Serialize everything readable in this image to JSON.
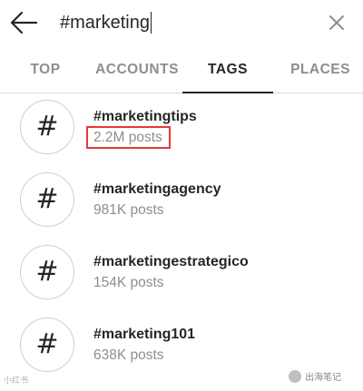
{
  "search": {
    "query": "#marketing"
  },
  "tabs": [
    {
      "label": "TOP",
      "active": false
    },
    {
      "label": "ACCOUNTS",
      "active": false
    },
    {
      "label": "TAGS",
      "active": true
    },
    {
      "label": "PLACES",
      "active": false
    }
  ],
  "results": [
    {
      "icon": "#",
      "name": "#marketingtips",
      "count": "2.2M posts",
      "highlighted": true
    },
    {
      "icon": "#",
      "name": "#marketingagency",
      "count": "981K posts",
      "highlighted": false
    },
    {
      "icon": "#",
      "name": "#marketingestrategico",
      "count": "154K posts",
      "highlighted": false
    },
    {
      "icon": "#",
      "name": "#marketing101",
      "count": "638K posts",
      "highlighted": false
    }
  ],
  "watermarks": {
    "left": "小红书",
    "right": "出海笔记"
  },
  "colors": {
    "highlight": "#e53935",
    "muted_text": "#8e8e8e",
    "primary_text": "#262626"
  },
  "icons": {
    "back": "arrow-left-icon",
    "clear": "close-icon",
    "tag": "hashtag-icon"
  }
}
